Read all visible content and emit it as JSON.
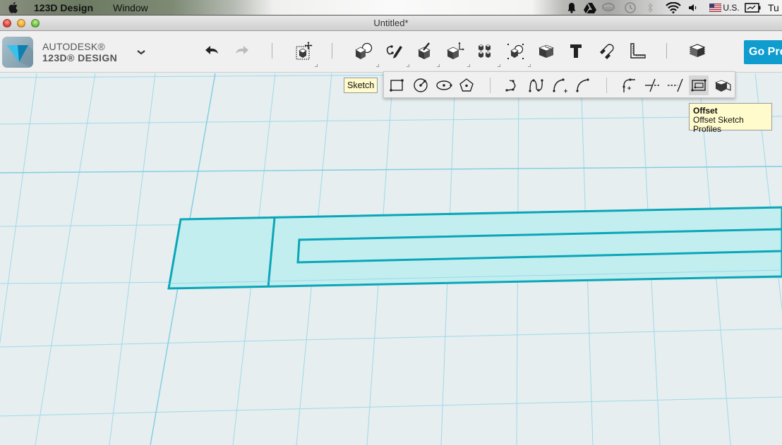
{
  "menubar": {
    "app_name": "123D Design",
    "menu_items": [
      "Window"
    ],
    "status": {
      "input_source": "U.S.",
      "clock_partial": "Tu",
      "icons": [
        "notification-bell-icon",
        "google-drive-icon",
        "teacup-icon",
        "time-machine-icon",
        "bluetooth-icon",
        "wifi-icon",
        "volume-icon",
        "us-flag-icon",
        "battery-icon"
      ]
    }
  },
  "window": {
    "title": "Untitled*"
  },
  "brand": {
    "line1": "AUTODESK®",
    "line2": "123D® DESIGN"
  },
  "toolbar": {
    "items": [
      {
        "name": "undo",
        "icon": "undo-arrow-icon"
      },
      {
        "name": "redo",
        "icon": "redo-arrow-icon",
        "disabled": true
      },
      {
        "name": "transform",
        "icon": "transform-icon"
      },
      {
        "name": "primitives",
        "icon": "primitives-icon"
      },
      {
        "name": "sketch",
        "icon": "sketch-icon"
      },
      {
        "name": "construct",
        "icon": "construct-icon"
      },
      {
        "name": "modify",
        "icon": "modify-icon"
      },
      {
        "name": "pattern",
        "icon": "pattern-icon"
      },
      {
        "name": "grouping",
        "icon": "grouping-icon"
      },
      {
        "name": "combine",
        "icon": "combine-icon"
      },
      {
        "name": "text",
        "icon": "text-icon"
      },
      {
        "name": "snap",
        "icon": "magnet-icon"
      },
      {
        "name": "measure",
        "icon": "ruler-icon"
      },
      {
        "name": "material",
        "icon": "material-layers-icon"
      }
    ],
    "premium_label": "Go Premium"
  },
  "sketch_flyout": {
    "tooltip": "Sketch",
    "tools": [
      {
        "name": "sketch-rectangle",
        "icon": "sketch-rectangle-icon"
      },
      {
        "name": "sketch-circle",
        "icon": "sketch-circle-icon"
      },
      {
        "name": "sketch-ellipse",
        "icon": "sketch-ellipse-icon"
      },
      {
        "name": "sketch-polygon",
        "icon": "sketch-polygon-icon"
      },
      {
        "name": "polyline",
        "icon": "polyline-icon"
      },
      {
        "name": "spline",
        "icon": "spline-icon"
      },
      {
        "name": "two-point-arc",
        "icon": "two-point-arc-icon"
      },
      {
        "name": "three-point-arc",
        "icon": "three-point-arc-icon"
      },
      {
        "name": "fillet",
        "icon": "fillet-icon"
      },
      {
        "name": "trim",
        "icon": "trim-icon"
      },
      {
        "name": "extend",
        "icon": "extend-icon"
      },
      {
        "name": "offset",
        "icon": "offset-icon",
        "active": true
      },
      {
        "name": "project",
        "icon": "project-icon"
      }
    ]
  },
  "offset_tooltip": {
    "title": "Offset",
    "description": "Offset Sketch Profiles"
  },
  "colors": {
    "accent": "#0f9ccf",
    "sketch_stroke": "#0aa6b8",
    "sketch_fill": "#c2eef0",
    "grid": "#9fd9e8",
    "viewport_bg": "#e6eef0",
    "tooltip_bg": "#fffbcc"
  }
}
